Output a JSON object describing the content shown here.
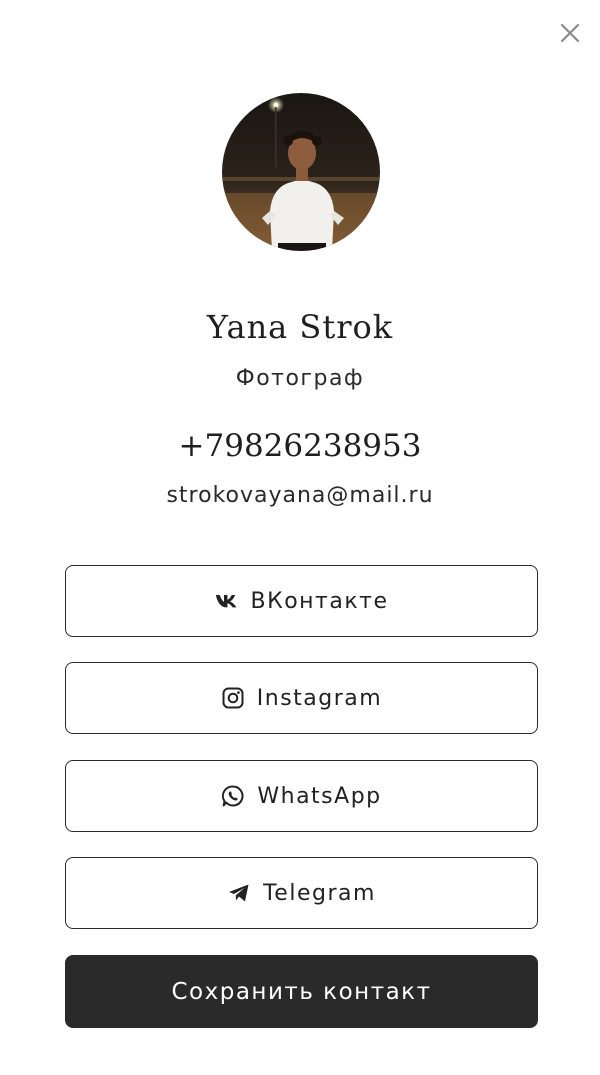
{
  "profile": {
    "name": "Yana Strok",
    "role": "Фотограф",
    "phone": "+79826238953",
    "email": "strokovayana@mail.ru",
    "avatar_icon": "avatar-photo"
  },
  "links": [
    {
      "label": "ВКонтакте",
      "icon": "vk-icon"
    },
    {
      "label": "Instagram",
      "icon": "instagram-icon"
    },
    {
      "label": "WhatsApp",
      "icon": "whatsapp-icon"
    },
    {
      "label": "Telegram",
      "icon": "telegram-icon"
    }
  ],
  "actions": {
    "save_label": "Сохранить контакт",
    "close_icon": "close-icon"
  },
  "colors": {
    "background": "#ffffff",
    "text": "#222222",
    "border": "#2b2b2b",
    "save_button_bg": "#2a2a2a",
    "save_button_text": "#ffffff",
    "close_icon": "#8a8a8a"
  }
}
